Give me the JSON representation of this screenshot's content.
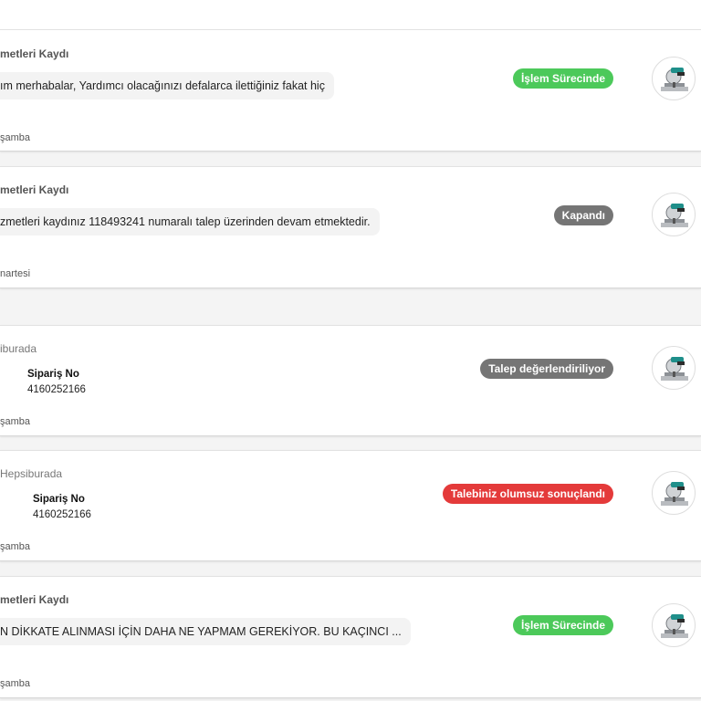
{
  "colors": {
    "green": "#4cc95a",
    "gray": "#757575",
    "red": "#e43a3a"
  },
  "icons": {
    "product": "miter-saw-product-image"
  },
  "requests": [
    {
      "title": "metleri Kaydı",
      "message": "ım merhabalar, Yardımcı olacağınızı defalarca ilettiğiniz fakat hiç",
      "day": "şamba",
      "status": "İşlem Sürecinde",
      "status_color": "green"
    },
    {
      "title": "metleri Kaydı",
      "message": "zmetleri kaydınız 118493241 numaralı talep üzerinden devam etmektedir.",
      "day": "nartesi",
      "status": "Kapandı",
      "status_color": "gray"
    },
    {
      "title": "iburada",
      "order_label": "Sipariş No",
      "order_no": "4160252166",
      "day": "şamba",
      "status": "Talep değerlendiriliyor",
      "status_color": "gray"
    },
    {
      "title": "Hepsiburada",
      "order_label": "Sipariş No",
      "order_no": "4160252166",
      "day": "şamba",
      "status": "Talebiniz olumsuz sonuçlandı",
      "status_color": "red"
    },
    {
      "title": "metleri Kaydı",
      "message": "N DİKKATE ALINMASI İÇİN DAHA NE YAPMAM GEREKİYOR. BU KAÇINCI ...",
      "day": "şamba",
      "status": "İşlem Sürecinde",
      "status_color": "green"
    }
  ]
}
